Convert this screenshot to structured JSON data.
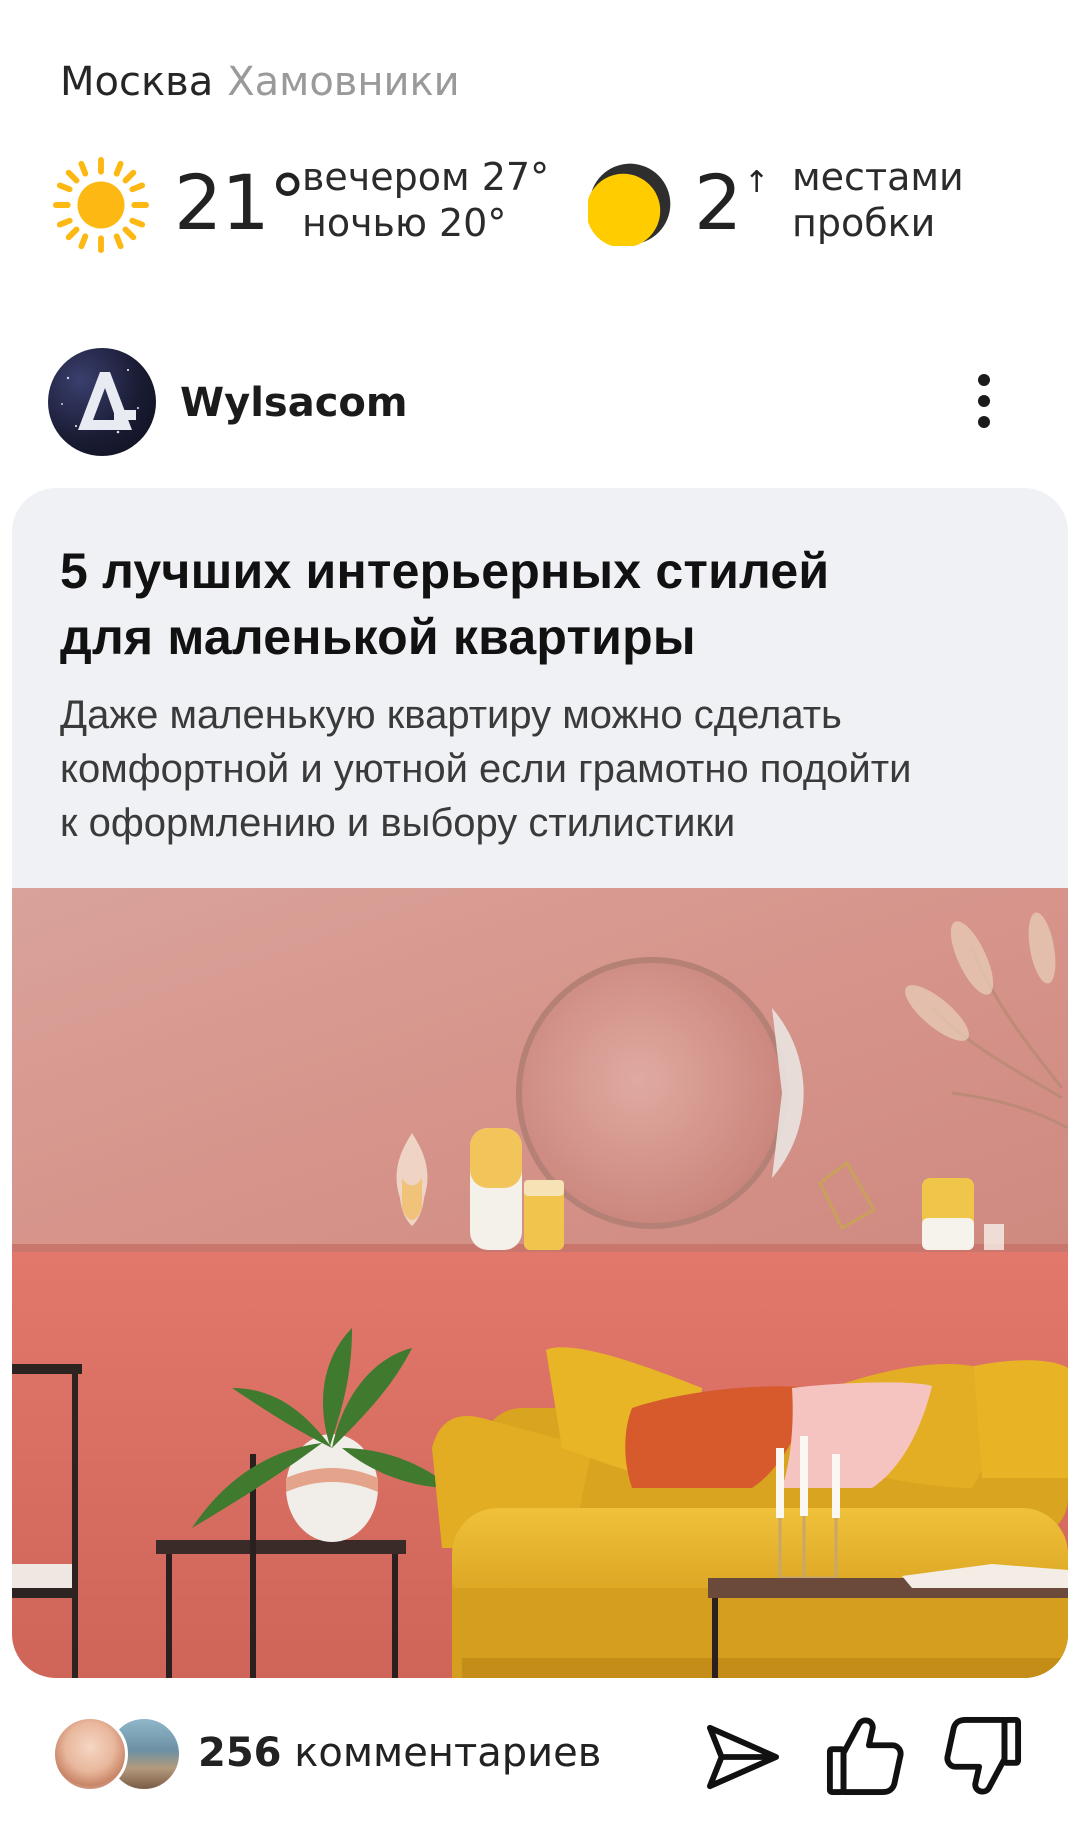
{
  "location": {
    "city": "Москва",
    "district": "Хамовники"
  },
  "weather": {
    "icon": "sun-icon",
    "temperature": "21°",
    "evening": "вечером 27°",
    "night": "ночью 20°"
  },
  "traffic": {
    "icon": "traffic-level-icon",
    "score": "2",
    "trend_icon": "arrow-up-icon",
    "trend_glyph": "↑",
    "desc_line1": "местами",
    "desc_line2": "пробки"
  },
  "channel": {
    "name": "Wylsacom",
    "avatar_letter": "A",
    "more_icon": "more-vertical-icon"
  },
  "article": {
    "title_line1": "5 лучших интерьерных стилей",
    "title_line2": "для маленькой квартиры",
    "desc_line1": "Даже маленькую квартиру можно сделать",
    "desc_line2": "комфортной и уютной если грамотно подойти",
    "desc_line3": "к оформлению и выбору стилистики"
  },
  "footer": {
    "comments_count": "256",
    "comments_label": " комментариев",
    "share_icon": "share-send-icon",
    "like_icon": "thumbs-up-icon",
    "dislike_icon": "thumbs-down-icon"
  },
  "colors": {
    "sun": "#FDB813",
    "traffic_yellow": "#FFCC00",
    "card_bg": "#F0F1F5",
    "wall_top": "#D89B92",
    "wall_bottom": "#E0766C",
    "sofa": "#E6B12A"
  }
}
